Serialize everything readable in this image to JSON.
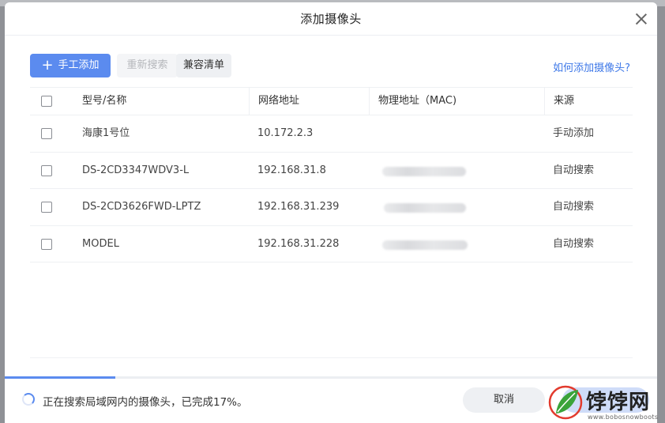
{
  "dialog": {
    "title": "添加摄像头"
  },
  "toolbar": {
    "manual_add_label": "手工添加",
    "rescan_label": "重新搜索",
    "compat_list_label": "兼容清单",
    "help_link": "如何添加摄像头?"
  },
  "table": {
    "columns": [
      "型号/名称",
      "网络地址",
      "物理地址（MAC)",
      "来源"
    ],
    "rows": [
      {
        "name": "海康1号位",
        "ip": "10.172.2.3",
        "mac": "",
        "source": "手动添加"
      },
      {
        "name": "DS-2CD3347WDV3-L",
        "ip": "192.168.31.8",
        "mac": "",
        "source": "自动搜索"
      },
      {
        "name": "DS-2CD3626FWD-LPTZ",
        "ip": "192.168.31.239",
        "mac": "",
        "source": "自动搜索"
      },
      {
        "name": "MODEL",
        "ip": "192.168.31.228",
        "mac": "",
        "source": "自动搜索"
      }
    ]
  },
  "status": {
    "text": "正在搜索局域网内的摄像头，已完成17%。",
    "progress": 0.17
  },
  "footer": {
    "cancel_label": "取消"
  },
  "watermark": {
    "text": "饽饽网",
    "url": "www.bobosnowboots"
  },
  "colors": {
    "primary": "#5b8bef",
    "link": "#3e78e8",
    "watermark_green": "#3aa33a"
  }
}
